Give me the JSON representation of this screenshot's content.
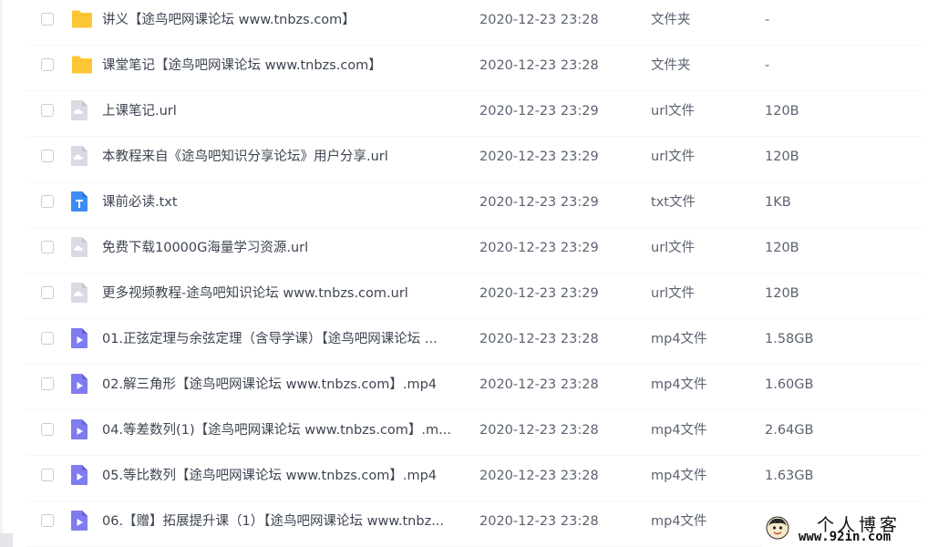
{
  "files": [
    {
      "name": "讲义【途鸟吧网课论坛 www.tnbzs.com】",
      "date": "2020-12-23 23:28",
      "type": "文件夹",
      "size": "-",
      "icon": "folder-icon"
    },
    {
      "name": "课堂笔记【途鸟吧网课论坛 www.tnbzs.com】",
      "date": "2020-12-23 23:28",
      "type": "文件夹",
      "size": "-",
      "icon": "folder-icon"
    },
    {
      "name": "上课笔记.url",
      "date": "2020-12-23 23:29",
      "type": "url文件",
      "size": "120B",
      "icon": "url-file-icon"
    },
    {
      "name": "本教程来自《途鸟吧知识分享论坛》用户分享.url",
      "date": "2020-12-23 23:29",
      "type": "url文件",
      "size": "120B",
      "icon": "url-file-icon"
    },
    {
      "name": "课前必读.txt",
      "date": "2020-12-23 23:29",
      "type": "txt文件",
      "size": "1KB",
      "icon": "text-file-icon"
    },
    {
      "name": "免费下载10000G海量学习资源.url",
      "date": "2020-12-23 23:29",
      "type": "url文件",
      "size": "120B",
      "icon": "url-file-icon"
    },
    {
      "name": "更多视频教程-途鸟吧知识论坛 www.tnbzs.com.url",
      "date": "2020-12-23 23:29",
      "type": "url文件",
      "size": "120B",
      "icon": "url-file-icon"
    },
    {
      "name": "01.正弦定理与余弦定理（含导学课）【途鸟吧网课论坛 ...",
      "date": "2020-12-23 23:28",
      "type": "mp4文件",
      "size": "1.58GB",
      "icon": "video-file-icon"
    },
    {
      "name": "02.解三角形【途鸟吧网课论坛 www.tnbzs.com】.mp4",
      "date": "2020-12-23 23:28",
      "type": "mp4文件",
      "size": "1.60GB",
      "icon": "video-file-icon"
    },
    {
      "name": "04.等差数列(1)【途鸟吧网课论坛 www.tnbzs.com】.m...",
      "date": "2020-12-23 23:28",
      "type": "mp4文件",
      "size": "2.64GB",
      "icon": "video-file-icon"
    },
    {
      "name": "05.等比数列【途鸟吧网课论坛 www.tnbzs.com】.mp4",
      "date": "2020-12-23 23:28",
      "type": "mp4文件",
      "size": "1.63GB",
      "icon": "video-file-icon"
    },
    {
      "name": "06.【赠】拓展提升课（1）【途鸟吧网课论坛 www.tnbz...",
      "date": "2020-12-23 23:28",
      "type": "mp4文件",
      "size": "",
      "icon": "video-file-icon"
    }
  ],
  "watermark": {
    "title": "个人博客",
    "url": "www.92in.com"
  },
  "colors": {
    "folder": "#fcc636",
    "url_file": "#d8dbe1",
    "text_file": "#3b8cf5",
    "video_file": "#7f7cf0"
  }
}
